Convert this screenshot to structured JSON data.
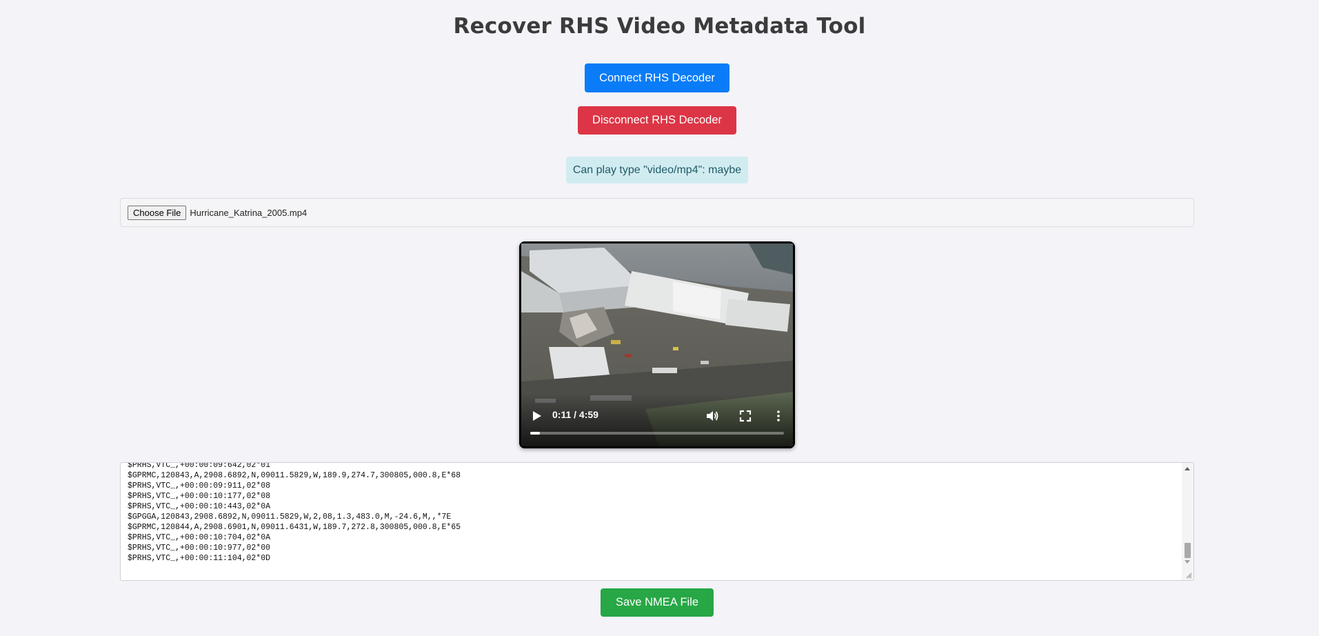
{
  "page": {
    "title": "Recover RHS Video Metadata Tool"
  },
  "buttons": {
    "connect_label": "Connect RHS Decoder",
    "disconnect_label": "Disconnect RHS Decoder",
    "save_label": "Save NMEA File"
  },
  "status": {
    "message": "Can play type \"video/mp4\": maybe"
  },
  "file_input": {
    "button_label": "Choose File",
    "file_name": "Hurricane_Katrina_2005.mp4"
  },
  "video_player": {
    "time_display": "0:11 / 4:59",
    "progress_fraction": 0.037,
    "icons": [
      "play-icon",
      "volume-icon",
      "fullscreen-icon",
      "more-options-icon"
    ]
  },
  "nmea_log": {
    "text": "$PRHS,VTC_,+00:00:09:642,02*01\n$GPRMC,120843,A,2908.6892,N,09011.5829,W,189.9,274.7,300805,000.8,E*68\n$PRHS,VTC_,+00:00:09:911,02*08\n$PRHS,VTC_,+00:00:10:177,02*08\n$PRHS,VTC_,+00:00:10:443,02*0A\n$GPGGA,120843,2908.6892,N,09011.5829,W,2,08,1.3,483.0,M,-24.6,M,,*7E\n$GPRMC,120844,A,2908.6901,N,09011.6431,W,189.7,272.8,300805,000.8,E*65\n$PRHS,VTC_,+00:00:10:704,02*0A\n$PRHS,VTC_,+00:00:10:977,02*00\n$PRHS,VTC_,+00:00:11:104,02*0D"
  },
  "colors": {
    "connect": "#0a7cf7",
    "disconnect": "#dc3546",
    "save": "#27a745",
    "status_bg": "#d1ecf1"
  }
}
